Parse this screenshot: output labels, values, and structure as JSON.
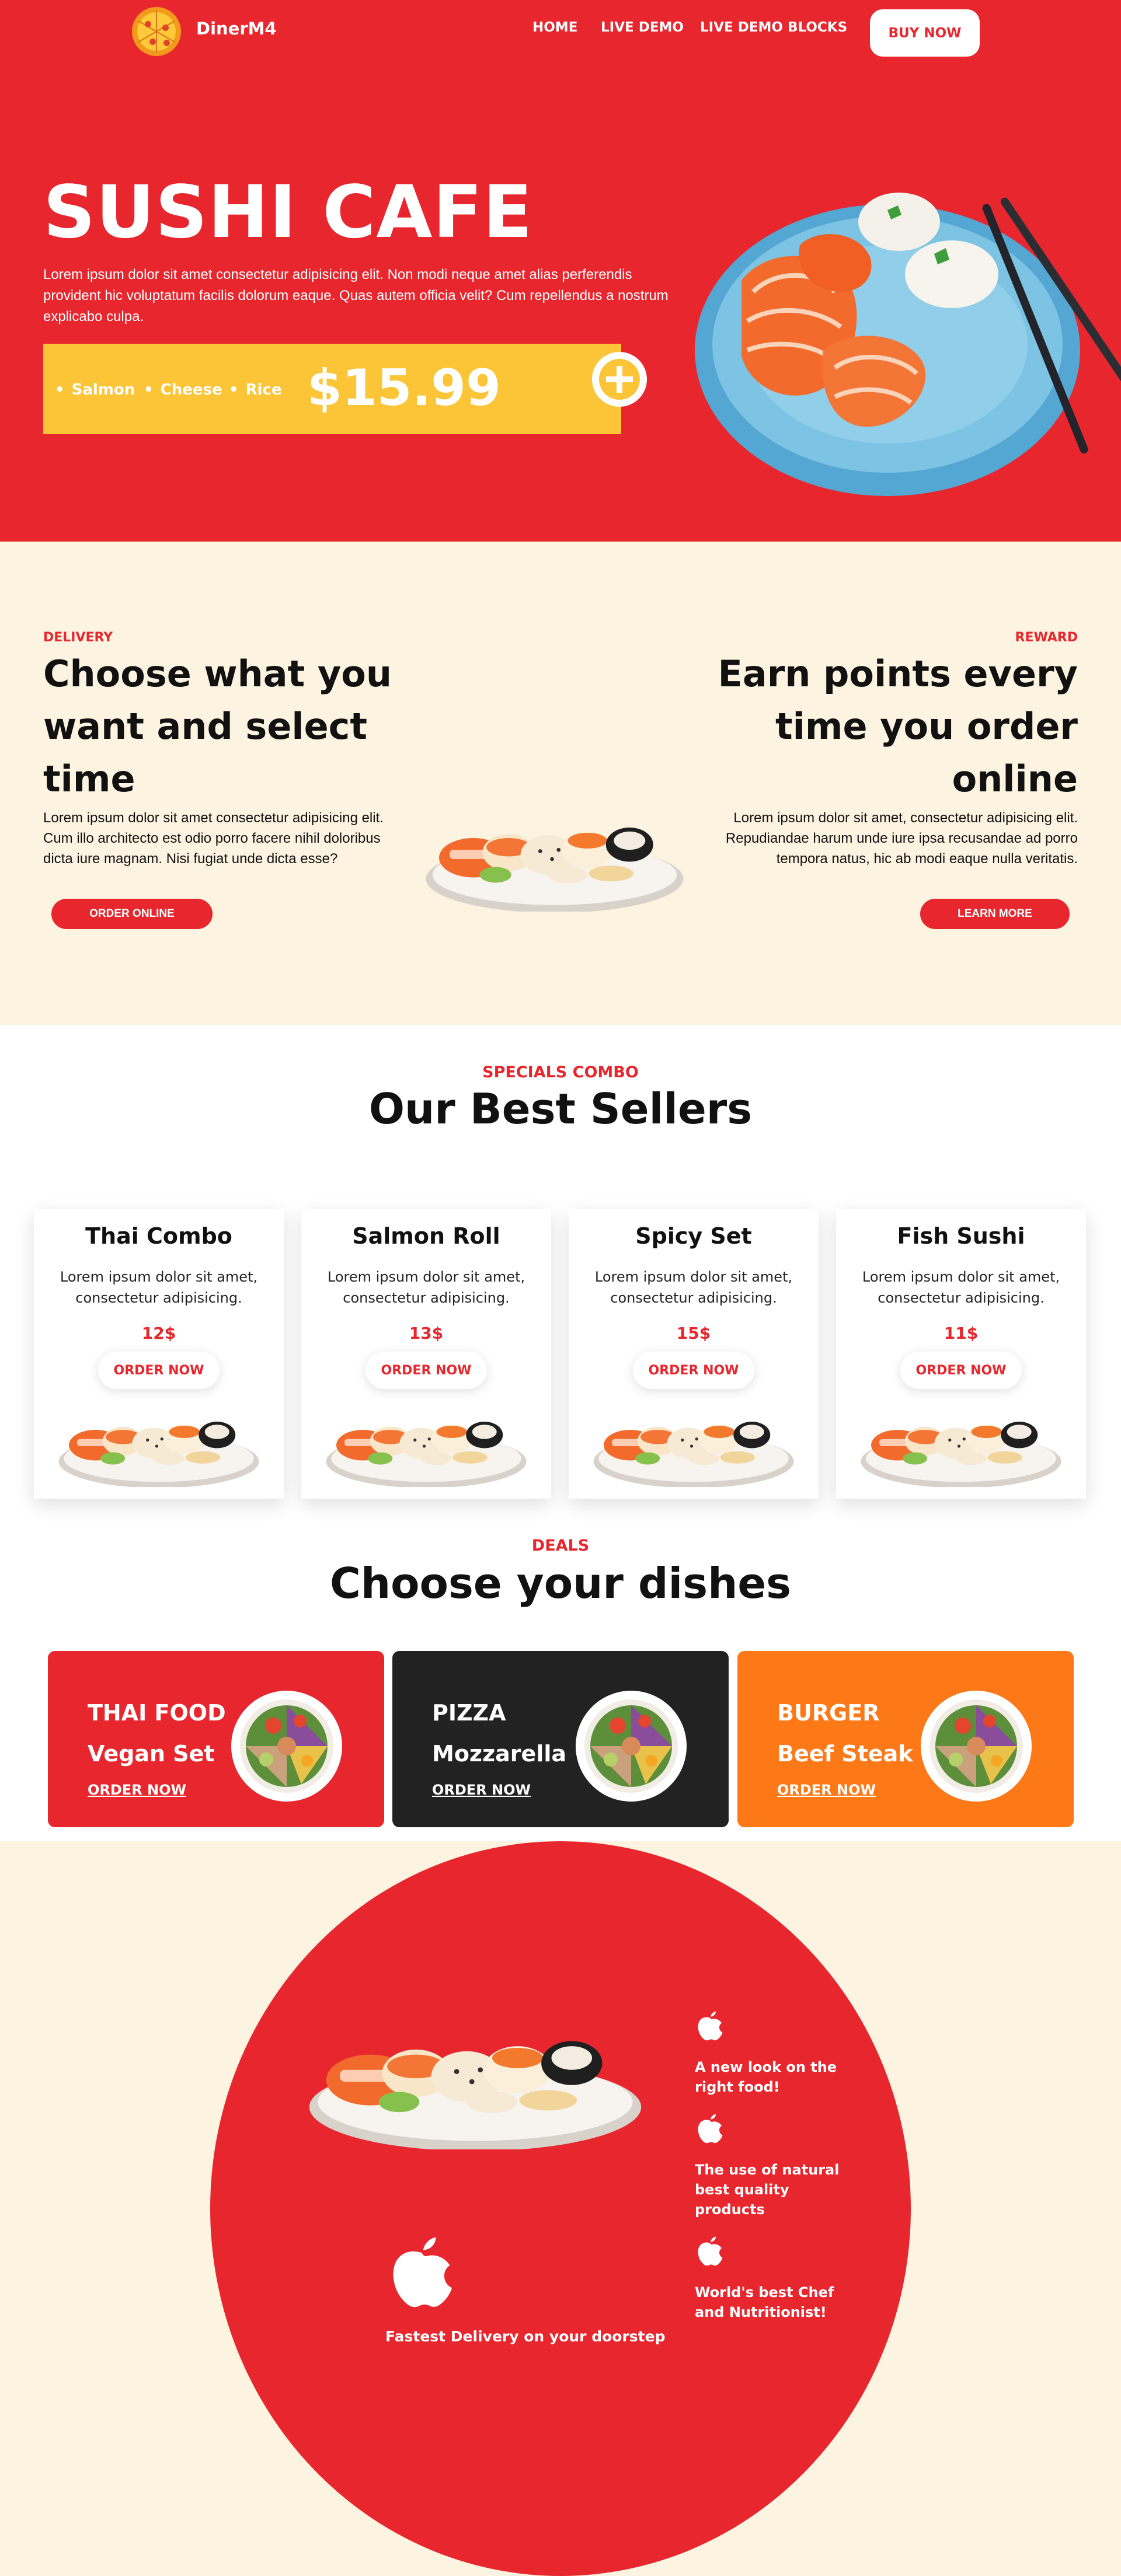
{
  "nav": {
    "brand": "DinerM4",
    "links": [
      "HOME",
      "LIVE DEMO",
      "LIVE DEMO BLOCKS"
    ],
    "buy_label": "BUY NOW"
  },
  "hero": {
    "title": "SUSHI CAFE",
    "text": "Lorem ipsum dolor sit amet consectetur adipisicing elit. Non modi neque amet alias perferendis provident hic voluptatum facilis dolorum eaque. Quas autem officia velit? Cum repellendus a nostrum explicabo culpa.",
    "ingredients": [
      "Salmon",
      "Cheese",
      "Rice"
    ],
    "price": "$15.99"
  },
  "delivery": {
    "kicker": "DELIVERY",
    "title": "Choose what you want and select time",
    "text": "Lorem ipsum dolor sit amet consectetur adipisicing elit. Cum illo architecto est odio porro facere nihil doloribus dicta iure magnam. Nisi fugiat unde dicta esse?",
    "button": "ORDER ONLINE"
  },
  "reward": {
    "kicker": "REWARD",
    "title": "Earn points every time you order online",
    "text": "Lorem ipsum dolor sit amet, consectetur adipisicing elit. Repudiandae harum unde iure ipsa recusandae ad porro tempora natus, hic ab modi eaque nulla veritatis.",
    "button": "LEARN MORE"
  },
  "sellers": {
    "kicker": "SPECIALS COMBO",
    "title": "Our Best Sellers",
    "cards": [
      {
        "name": "Thai Combo",
        "desc": "Lorem ipsum dolor sit amet, consectetur adipisicing.",
        "price": "12$",
        "button": "ORDER NOW"
      },
      {
        "name": "Salmon Roll",
        "desc": "Lorem ipsum dolor sit amet, consectetur adipisicing.",
        "price": "13$",
        "button": "ORDER NOW"
      },
      {
        "name": "Spicy Set",
        "desc": "Lorem ipsum dolor sit amet, consectetur adipisicing.",
        "price": "15$",
        "button": "ORDER NOW"
      },
      {
        "name": "Fish Sushi",
        "desc": "Lorem ipsum dolor sit amet, consectetur adipisicing.",
        "price": "11$",
        "button": "ORDER NOW"
      }
    ]
  },
  "deals": {
    "kicker": "DEALS",
    "title": "Choose your dishes",
    "items": [
      {
        "name": "THAI FOOD",
        "sub": "Vegan Set",
        "link": "ORDER NOW",
        "color": "#e7262e"
      },
      {
        "name": "PIZZA",
        "sub": "Mozzarella",
        "link": "ORDER NOW",
        "color": "#222222"
      },
      {
        "name": "BURGER",
        "sub": "Beef Steak",
        "link": "ORDER NOW",
        "color": "#fd7917"
      }
    ]
  },
  "features": {
    "items": [
      "A new look on the right food!",
      "The use of natural best quality products",
      "World's best Chef and Nutritionist!"
    ],
    "delivery": "Fastest Delivery on your doorstep"
  },
  "colors": {
    "primary_red": "#e7262e",
    "accent_yellow": "#fcc437",
    "cream": "#fdf3e1",
    "orange": "#fd7917",
    "dark": "#222222"
  },
  "icons": [
    "pizza-logo-icon",
    "plus-icon",
    "apple-icon"
  ]
}
